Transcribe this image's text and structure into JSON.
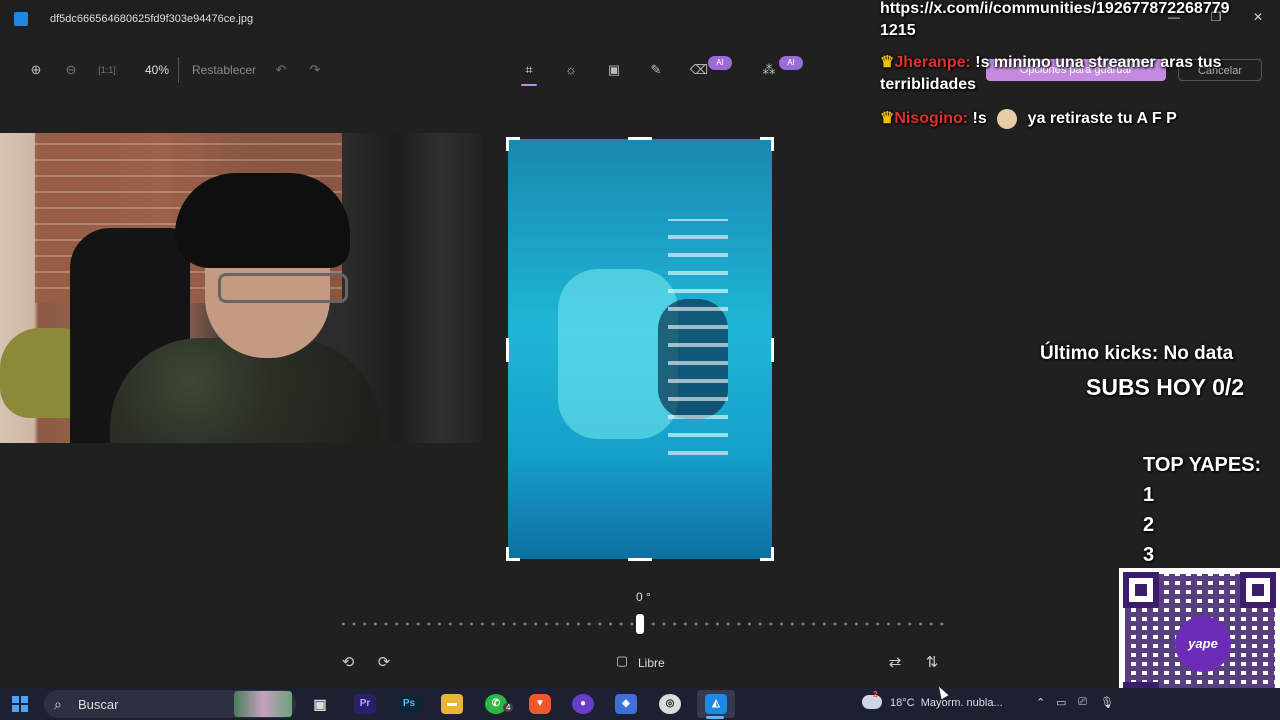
{
  "window": {
    "file_name": "df5dc666564680625fd9f303e94476ce.jpg"
  },
  "toolbar": {
    "zoom_value": "40%",
    "reset_label": "Restablecer",
    "ai_badge": "AI"
  },
  "editor": {
    "rotation_value": "0 °",
    "aspect_label": "Libre"
  },
  "overlay": {
    "url_line1": "https://x.com/i/communities/192677872268779",
    "url_line2": "1215",
    "hidden_save": "Opciones para guardar",
    "hidden_cancel": "Cancelar",
    "chat1_name": "Jheranpe:",
    "chat1_text": " !s minimo una streamer aras tus terriblidades",
    "chat2_name": "Nisogino:",
    "chat2_cmd": " !s ",
    "chat2_text": " ya retiraste tu A F P",
    "kicks": "Último kicks: No data",
    "subs": "SUBS HOY 0/2",
    "yapes_title": "TOP YAPES:",
    "ranks": [
      "1",
      "2",
      "3"
    ],
    "qr_logo": "yape"
  },
  "taskbar": {
    "search_text": "Buscar",
    "whatsapp_badge": "4",
    "weather_temp": "18°C",
    "weather_desc": "Mayorm. nubla...",
    "weather_badge": "2"
  },
  "colors": {
    "accent": "#c08be8",
    "ai_badge": "#9b6bd8",
    "chat_name": "#e0302e",
    "yape": "#6c2cb8"
  }
}
